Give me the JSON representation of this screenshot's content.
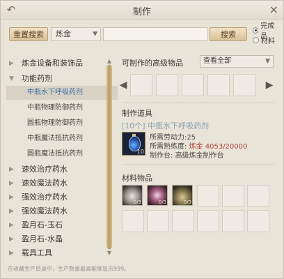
{
  "window": {
    "title": "制作"
  },
  "search": {
    "reset_label": "重置搜索",
    "category_value": "炼金",
    "query_value": "",
    "search_label": "搜索",
    "options": [
      {
        "label": "完成品",
        "checked": true
      },
      {
        "label": "材料",
        "checked": false
      }
    ]
  },
  "tree": {
    "items": [
      {
        "label": "炼金设备和装饰品",
        "level": 1,
        "expanded": false
      },
      {
        "label": "功能药剂",
        "level": 1,
        "expanded": true
      },
      {
        "label": "中瓶水下呼吸药剂",
        "level": 2,
        "selected": true
      },
      {
        "label": "中瓶物理防御药剂",
        "level": 2
      },
      {
        "label": "圆瓶物理防御药剂",
        "level": 2
      },
      {
        "label": "中瓶魔法抵抗药剂",
        "level": 2
      },
      {
        "label": "圆瓶魔法抵抗药剂",
        "level": 2
      },
      {
        "label": "速效治疗药水",
        "level": 1,
        "expanded": false
      },
      {
        "label": "速效魔法药水",
        "level": 1,
        "expanded": false
      },
      {
        "label": "强效治疗药水",
        "level": 1,
        "expanded": false
      },
      {
        "label": "强效魔法药水",
        "level": 1,
        "expanded": false
      },
      {
        "label": "盈月石-玉石",
        "level": 1,
        "expanded": false
      },
      {
        "label": "盈月石-水晶",
        "level": 1,
        "expanded": false
      },
      {
        "label": "载具工具",
        "level": 1,
        "expanded": false
      }
    ]
  },
  "advanced": {
    "title": "可制作的高级物品",
    "filter_value": "查看全部"
  },
  "tool": {
    "section_title": "制作道具",
    "item_name": "[10个] 中瓶水下呼吸药剂",
    "icon_count": "10",
    "labor_label": "所需劳动力:",
    "labor_value": "25",
    "proficiency_label": "所需熟练度:",
    "proficiency_value": "炼金 4053/20000",
    "station_label": "制作台:",
    "station_value": "高级炼金制作台"
  },
  "materials": {
    "title": "材料物品",
    "items": [
      {
        "count": "0/3"
      },
      {
        "count": "0/3"
      },
      {
        "count": "0/3"
      }
    ]
  },
  "footer": "在收藏生产目录中，生产数量最高能够显示999。",
  "colors": {
    "accent_red": "#b0433b",
    "selected_blue": "#3f6fa0",
    "button_gold": "#d9c199"
  }
}
